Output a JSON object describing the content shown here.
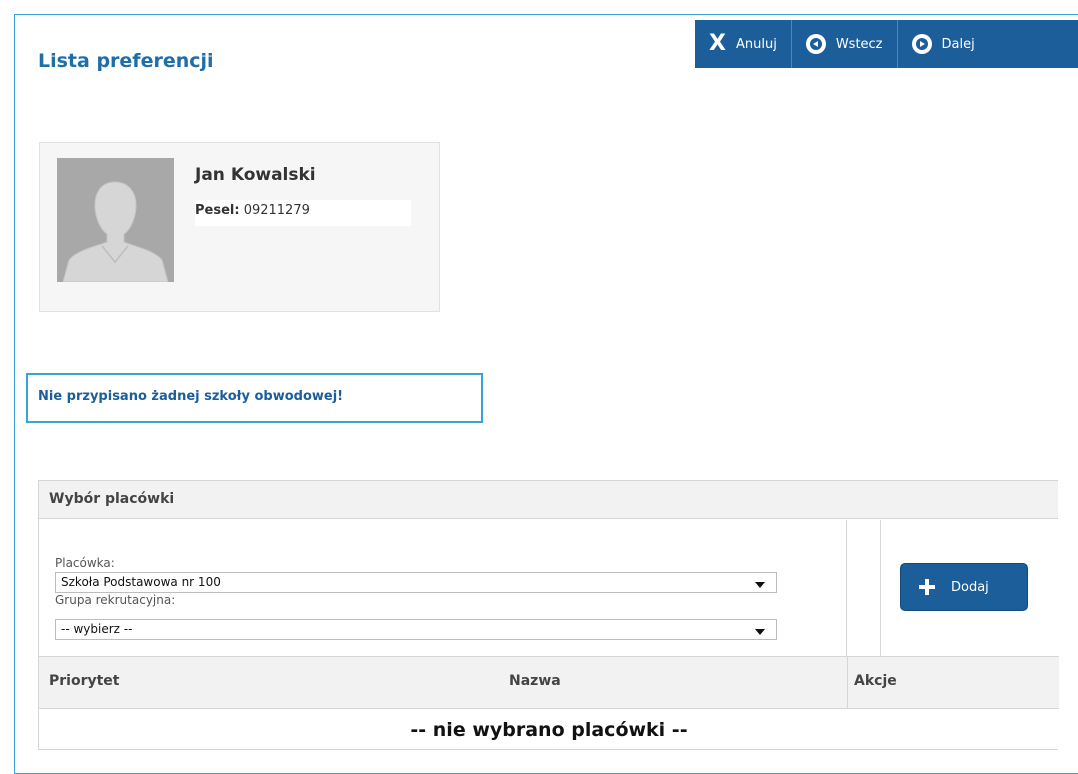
{
  "page": {
    "title": "Lista preferencji"
  },
  "toolbar": {
    "cancel_label": "Anuluj",
    "back_label": "Wstecz",
    "next_label": "Dalej"
  },
  "profile": {
    "name": "Jan Kowalski",
    "pesel_label": "Pesel:",
    "pesel_value": "09211279"
  },
  "alert": {
    "text": "Nie przypisano żadnej szkoły obwodowej!"
  },
  "selection_panel": {
    "title": "Wybór placówki",
    "placowka_label": "Placówka:",
    "placowka_value": "Szkoła Podstawowa nr 100",
    "grupa_label": "Grupa rekrutacyjna:",
    "grupa_value": "-- wybierz --",
    "add_label": "Dodaj"
  },
  "table": {
    "columns": [
      "Priorytet",
      "Nazwa",
      "Akcje"
    ],
    "empty_text": "-- nie wybrano placówki --"
  },
  "colors": {
    "primary": "#1c5e99",
    "accent_border": "#3aa3d6",
    "title": "#1f6ea7"
  }
}
